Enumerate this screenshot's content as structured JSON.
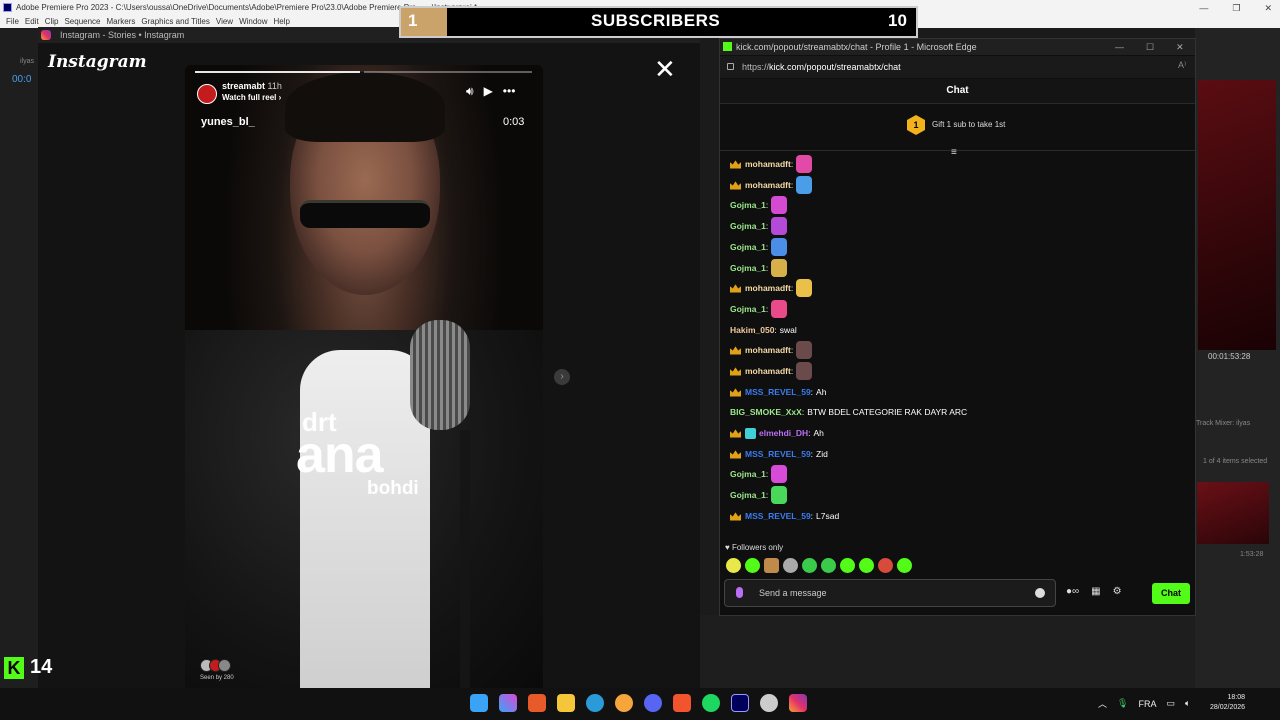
{
  "premiere": {
    "title": "Adobe Premiere Pro 2023 - C:\\Users\\oussa\\OneDrive\\Documents\\Adobe\\Premiere Pro\\23.0\\Adobe Premiere Pro... ...\\Instr.prproj *",
    "menu": [
      "File",
      "Edit",
      "Clip",
      "Sequence",
      "Markers",
      "Graphics and Titles",
      "View",
      "Window",
      "Help"
    ],
    "left_label": "ilyas",
    "left_timecode": "00:0",
    "right_timecode": "00:01:53:28",
    "track_mixer": "Track Mixer: ilyas",
    "items_selected": "1 of 4 items selected",
    "clip_duration": "1:53:28"
  },
  "instagram": {
    "tab_title": "Instagram - Stories • Instagram",
    "wordmark": "Instagram",
    "close_label": "✕",
    "story": {
      "username": "streamabt",
      "age": "11h",
      "watch_full_reel": "Watch full reel ›",
      "author": "yunes_bl_",
      "time": "0:03",
      "caption_top": "drt",
      "caption_main": "ana",
      "caption_bottom": "bohdi",
      "seen_by": "Seen by 280"
    }
  },
  "kick_widget": {
    "logo": "K",
    "count": "14"
  },
  "sub_goal": {
    "start": "1",
    "label": "SUBSCRIBERS",
    "end": "10",
    "progress": 0.09
  },
  "edge": {
    "window_title": "kick.com/popout/streamabtx/chat - Profile 1 - Microsoft Edge",
    "url_prefix": "https://",
    "url_main": "kick.com/popout/streamabtx/chat",
    "chat_header": "Chat",
    "gift_badge": "1",
    "gift_text": "Gift 1 sub to take 1st",
    "messages": [
      {
        "name": "mohamadft",
        "color": "#f3d9a6",
        "crown": true,
        "text": "",
        "emote": "#e34aa8"
      },
      {
        "name": "mohamadft",
        "color": "#f3d9a6",
        "crown": true,
        "text": "",
        "emote": "#4a9ee8"
      },
      {
        "name": "Gojma_1",
        "color": "#9be88a",
        "crown": false,
        "text": "",
        "emote": "#d44ad0"
      },
      {
        "name": "Gojma_1",
        "color": "#9be88a",
        "crown": false,
        "text": "",
        "emote": "#b34ad8"
      },
      {
        "name": "Gojma_1",
        "color": "#9be88a",
        "crown": false,
        "text": "",
        "emote": "#4a8ee8"
      },
      {
        "name": "Gojma_1",
        "color": "#9be88a",
        "crown": false,
        "text": "",
        "emote": "#d8b04a"
      },
      {
        "name": "mohamadft",
        "color": "#f3d9a6",
        "crown": true,
        "text": "",
        "emote": "#e8c04a"
      },
      {
        "name": "Gojma_1",
        "color": "#9be88a",
        "crown": false,
        "text": "",
        "emote": "#e84a8a"
      },
      {
        "name": "Hakim_050",
        "color": "#f3c9a0",
        "crown": false,
        "text": "swal",
        "emote": ""
      },
      {
        "name": "mohamadft",
        "color": "#f3d9a6",
        "crown": true,
        "text": "",
        "emote": "#6a4a4a"
      },
      {
        "name": "mohamadft",
        "color": "#f3d9a6",
        "crown": true,
        "text": "",
        "emote": "#6a4a4a"
      },
      {
        "name": "MSS_REVEL_59",
        "color": "#3b7cf0",
        "crown": true,
        "text": "Ah",
        "emote": ""
      },
      {
        "name": "BIG_SMOKE_XxX",
        "color": "#9be88a",
        "crown": false,
        "text": "BTW BDEL CATEGORIE RAK DAYR ARC",
        "emote": ""
      },
      {
        "name": "elmehdi_DH",
        "color": "#b86ff5",
        "crown": true,
        "badge2": true,
        "text": "Ah",
        "emote": ""
      },
      {
        "name": "MSS_REVEL_59",
        "color": "#3b7cf0",
        "crown": true,
        "text": "Zid",
        "emote": ""
      },
      {
        "name": "Gojma_1",
        "color": "#9be88a",
        "crown": false,
        "text": "",
        "emote": "#d84ad8"
      },
      {
        "name": "Gojma_1",
        "color": "#9be88a",
        "crown": false,
        "text": "",
        "emote": "#4ad85a"
      },
      {
        "name": "MSS_REVEL_59",
        "color": "#3b7cf0",
        "crown": true,
        "text": "L7sad",
        "emote": ""
      }
    ],
    "followers_only": "♥ Followers only",
    "input_placeholder": "Send a message",
    "send_label": "Chat"
  },
  "taskbar": {
    "language": "FRA",
    "time": "18:08",
    "date": "28/02/2026"
  }
}
